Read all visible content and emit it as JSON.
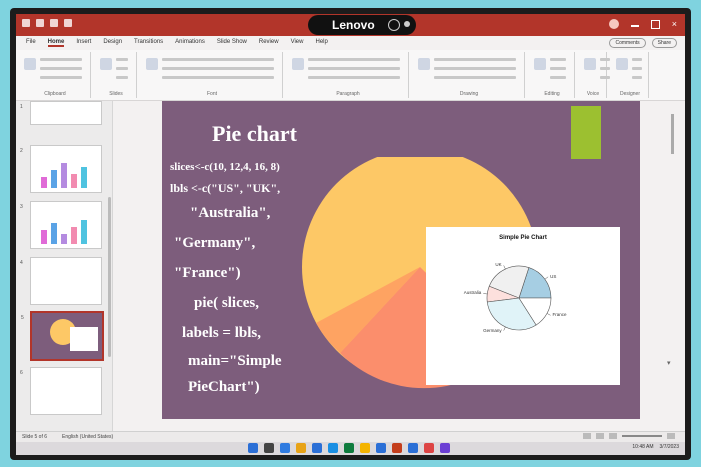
{
  "app": {
    "brand": "Lenovo",
    "accent_color": "#b2352a"
  },
  "menubar": {
    "tabs": [
      "File",
      "Home",
      "Insert",
      "Design",
      "Transitions",
      "Animations",
      "Slide Show",
      "Review",
      "View",
      "Help"
    ],
    "active_tab": "Home",
    "share_label": "Share",
    "comments_label": "Comments"
  },
  "ribbon": {
    "groups": [
      "Clipboard",
      "Slides",
      "Font",
      "Paragraph",
      "Drawing",
      "Editing",
      "Voice",
      "Designer"
    ]
  },
  "thumbnails": {
    "count": 6,
    "active_index": 4
  },
  "slide": {
    "title": "Pie chart",
    "code_lines": [
      "slices<-c(10, 12,4, 16, 8)",
      "lbls <-c(\"US\", \"UK\",",
      "\"Australia\",",
      "\"Germany\",",
      "\"France\")",
      "pie( slices,",
      "labels = lbls,",
      "main=\"Simple",
      "PieChart\")"
    ],
    "large_pie_colors": [
      "#fdc866",
      "#fb8e6c",
      "#fea362"
    ],
    "accent_block_color": "#9cc030",
    "background_color": "#7d5d7c"
  },
  "plot": {
    "title": "Simple Pie Chart",
    "labels": [
      "US",
      "UK",
      "Australia",
      "Germany",
      "France"
    ]
  },
  "chart_data": {
    "type": "pie",
    "title": "Simple Pie Chart",
    "categories": [
      "US",
      "UK",
      "Australia",
      "Germany",
      "France"
    ],
    "values": [
      10,
      12,
      4,
      16,
      8
    ],
    "colors": [
      "#a6cee3",
      "#f0f0f0",
      "#fde0dd",
      "#e0f3f8",
      "#ffffff"
    ]
  },
  "statusbar": {
    "left": "Slide 5 of 6",
    "lang": "English (United States)"
  },
  "taskbar": {
    "time": "10:48 AM",
    "date": "3/7/2023"
  }
}
